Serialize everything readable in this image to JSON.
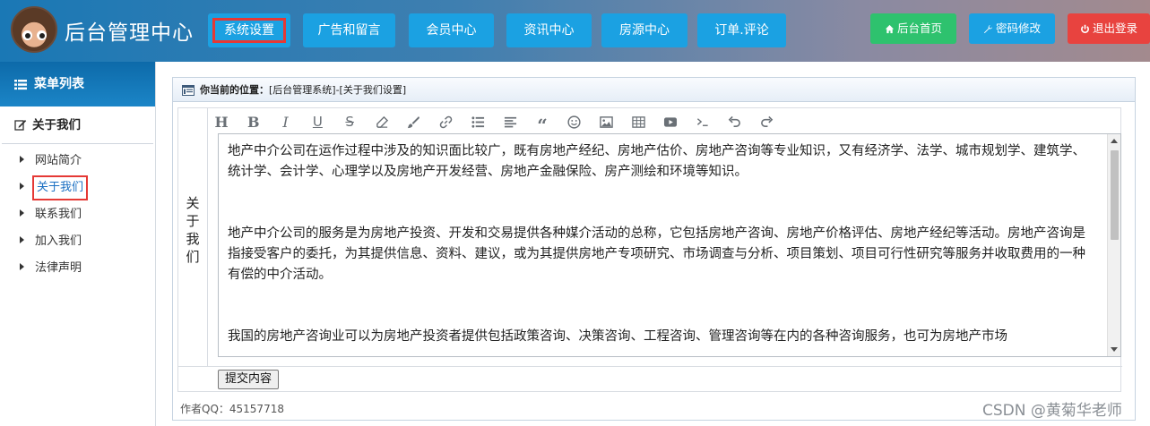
{
  "header": {
    "title": "后台管理中心",
    "nav": [
      "系统设置",
      "广告和留言",
      "会员中心",
      "资讯中心",
      "房源中心",
      "订单.评论"
    ],
    "right_buttons": [
      {
        "label": "后台首页",
        "icon": "home-icon",
        "color": "#2ec26e"
      },
      {
        "label": "密码修改",
        "icon": "wrench-icon",
        "color": "#1ba1e2"
      },
      {
        "label": "退出登录",
        "icon": "power-icon",
        "color": "#e8433f"
      }
    ]
  },
  "sidebar": {
    "menu_title": "菜单列表",
    "group_title": "关于我们",
    "items": [
      "网站简介",
      "关于我们",
      "联系我们",
      "加入我们",
      "法律声明"
    ],
    "active_index": 1
  },
  "panel": {
    "location_label": "你当前的位置：",
    "location_path": "[后台管理系统]-[关于我们设置]",
    "field_label": "关于我们",
    "toolbar_icons": [
      "heading-icon",
      "bold-icon",
      "italic-icon",
      "underline-icon",
      "strikethrough-icon",
      "eraser-icon",
      "brush-icon",
      "link-icon",
      "list-icon",
      "align-left-icon",
      "quote-icon",
      "emoji-icon",
      "image-icon",
      "table-icon",
      "video-icon",
      "code-icon",
      "undo-icon",
      "redo-icon"
    ],
    "content": [
      "地产中介公司在运作过程中涉及的知识面比较广，既有房地产经纪、房地产估价、房地产咨询等专业知识，又有经济学、法学、城市规划学、建筑学、统计学、会计学、心理学以及房地产开发经营、房地产金融保险、房产测绘和环境等知识。",
      "",
      " 地产中介公司的服务是为房地产投资、开发和交易提供各种媒介活动的总称，它包括房地产咨询、房地产价格评估、房地产经纪等活动。房地产咨询是指接受客户的委托，为其提供信息、资料、建议，或为其提供房地产专项研究、市场调查与分析、项目策划、项目可行性研究等服务并收取费用的一种有偿的中介活动。",
      "",
      "我国的房地产咨询业可以为房地产投资者提供包括政策咨询、决策咨询、工程咨询、管理咨询等在内的各种咨询服务，也可为房地产市场"
    ],
    "submit_label": "提交内容",
    "footer": "作者QQ：45157718"
  },
  "watermark": "CSDN @黄菊华老师",
  "colors": {
    "nav_blue": "#1ba1e2",
    "accent_red": "#e53935",
    "active_link": "#1a6fc2"
  }
}
